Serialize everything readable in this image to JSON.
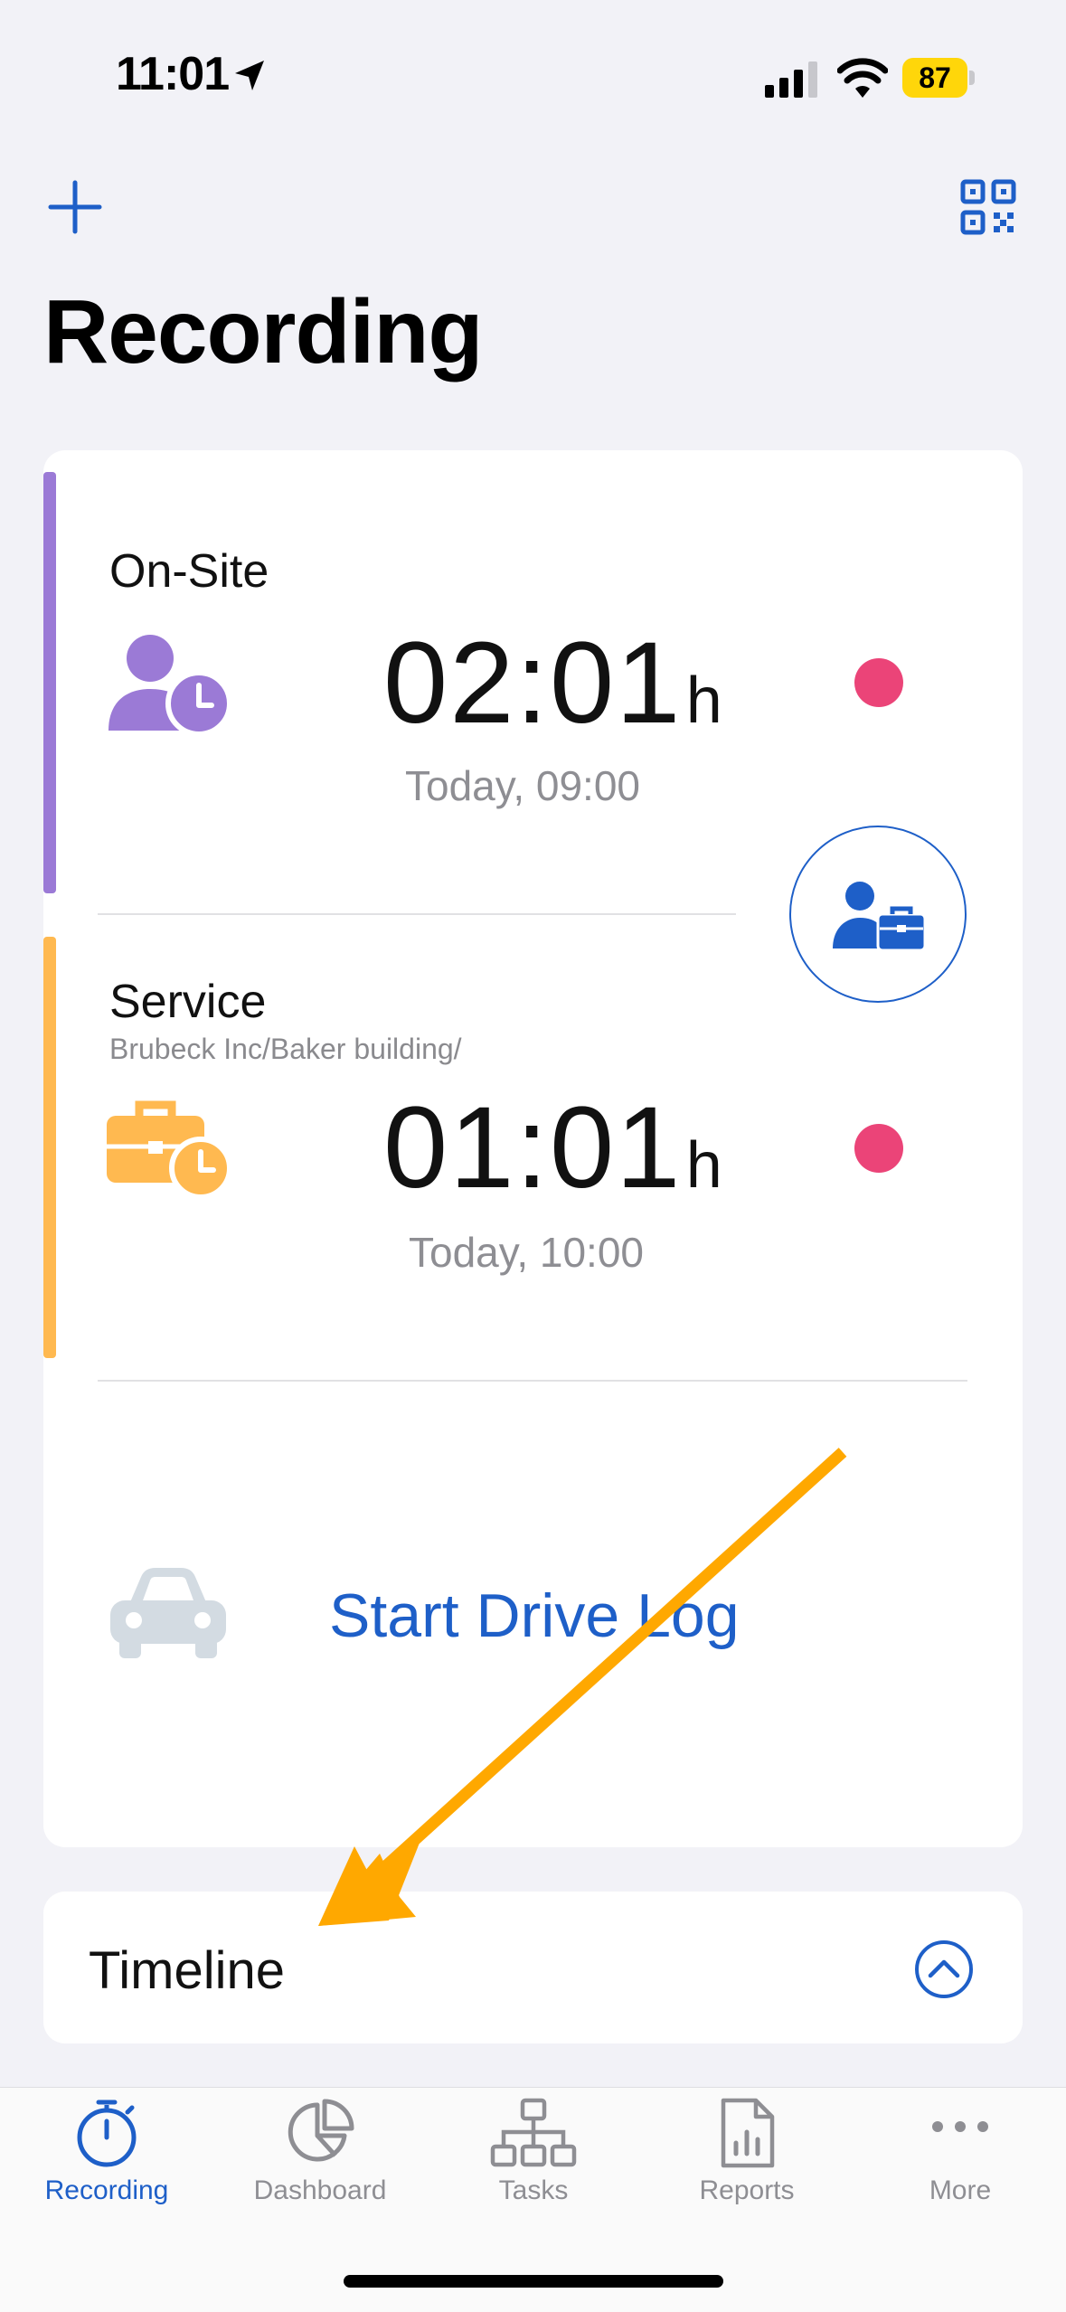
{
  "status_bar": {
    "time": "11:01",
    "battery": "87"
  },
  "header": {
    "title": "Recording"
  },
  "entries": [
    {
      "label": "On-Site",
      "sublabel": "",
      "duration": "02:01",
      "unit": "h",
      "since": "Today, 09:00",
      "bar_color": "#9b7ad6",
      "icon": "person-clock-icon"
    },
    {
      "label": "Service",
      "sublabel": "Brubeck Inc/Baker building/",
      "duration": "01:01",
      "unit": "h",
      "since": "Today, 10:00",
      "bar_color": "#ffb950",
      "icon": "briefcase-clock-icon"
    }
  ],
  "drive_log": {
    "label": "Start Drive Log",
    "icon": "car-icon"
  },
  "timeline": {
    "label": "Timeline"
  },
  "tabs": [
    {
      "label": "Recording",
      "icon": "stopwatch-icon",
      "active": true
    },
    {
      "label": "Dashboard",
      "icon": "pie-chart-icon",
      "active": false
    },
    {
      "label": "Tasks",
      "icon": "hierarchy-icon",
      "active": false
    },
    {
      "label": "Reports",
      "icon": "report-icon",
      "active": false
    },
    {
      "label": "More",
      "icon": "more-icon",
      "active": false
    }
  ],
  "colors": {
    "accent": "#1e5fc8",
    "recording_dot": "#eb4478",
    "onsite": "#9b7ad6",
    "service": "#ffb950",
    "annotation_arrow": "#ffa800"
  }
}
